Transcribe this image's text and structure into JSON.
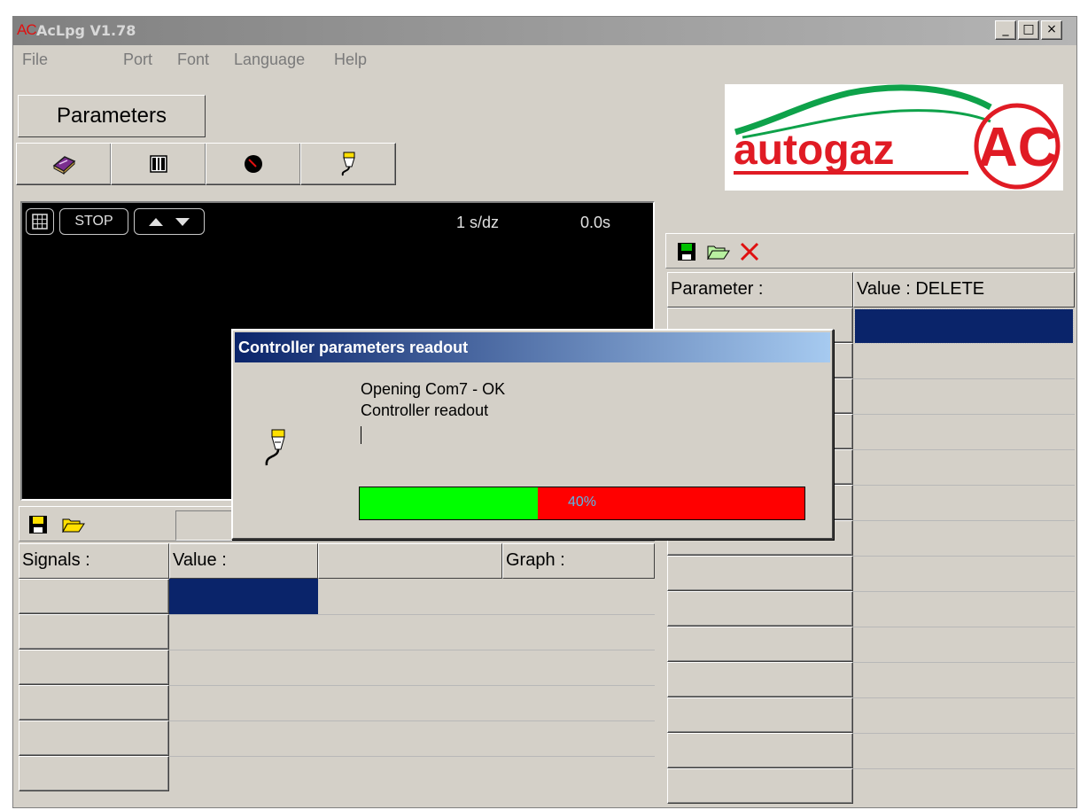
{
  "window": {
    "app_icon_text": "AC",
    "title": "AcLpg V1.78",
    "controls": [
      "_",
      "□",
      "×"
    ]
  },
  "menu": [
    "File",
    "Port",
    "Font",
    "Language",
    "Help"
  ],
  "tab_label": "Parameters",
  "toolbar_icons": [
    "book-icon",
    "columns-icon",
    "gauge-icon",
    "connector-icon"
  ],
  "logo": {
    "text": "autogaz",
    "mark": "AC",
    "colors": {
      "red": "#e01b24",
      "green": "#0ea24a"
    }
  },
  "scope": {
    "buttons": [
      "STOP"
    ],
    "rate": "1 s/dz",
    "time": "0.0s"
  },
  "signals_panel": {
    "headers": [
      "Signals :",
      "Value :",
      "",
      "Graph :"
    ],
    "selected_color": "#0a246a"
  },
  "params_panel": {
    "headers": [
      "Parameter :",
      "Value : DELETE"
    ]
  },
  "dialog": {
    "title": "Controller parameters readout",
    "lines": [
      "Opening Com7 -  OK",
      "Controller readout"
    ],
    "progress": {
      "percent": 40,
      "label": "40%"
    }
  }
}
